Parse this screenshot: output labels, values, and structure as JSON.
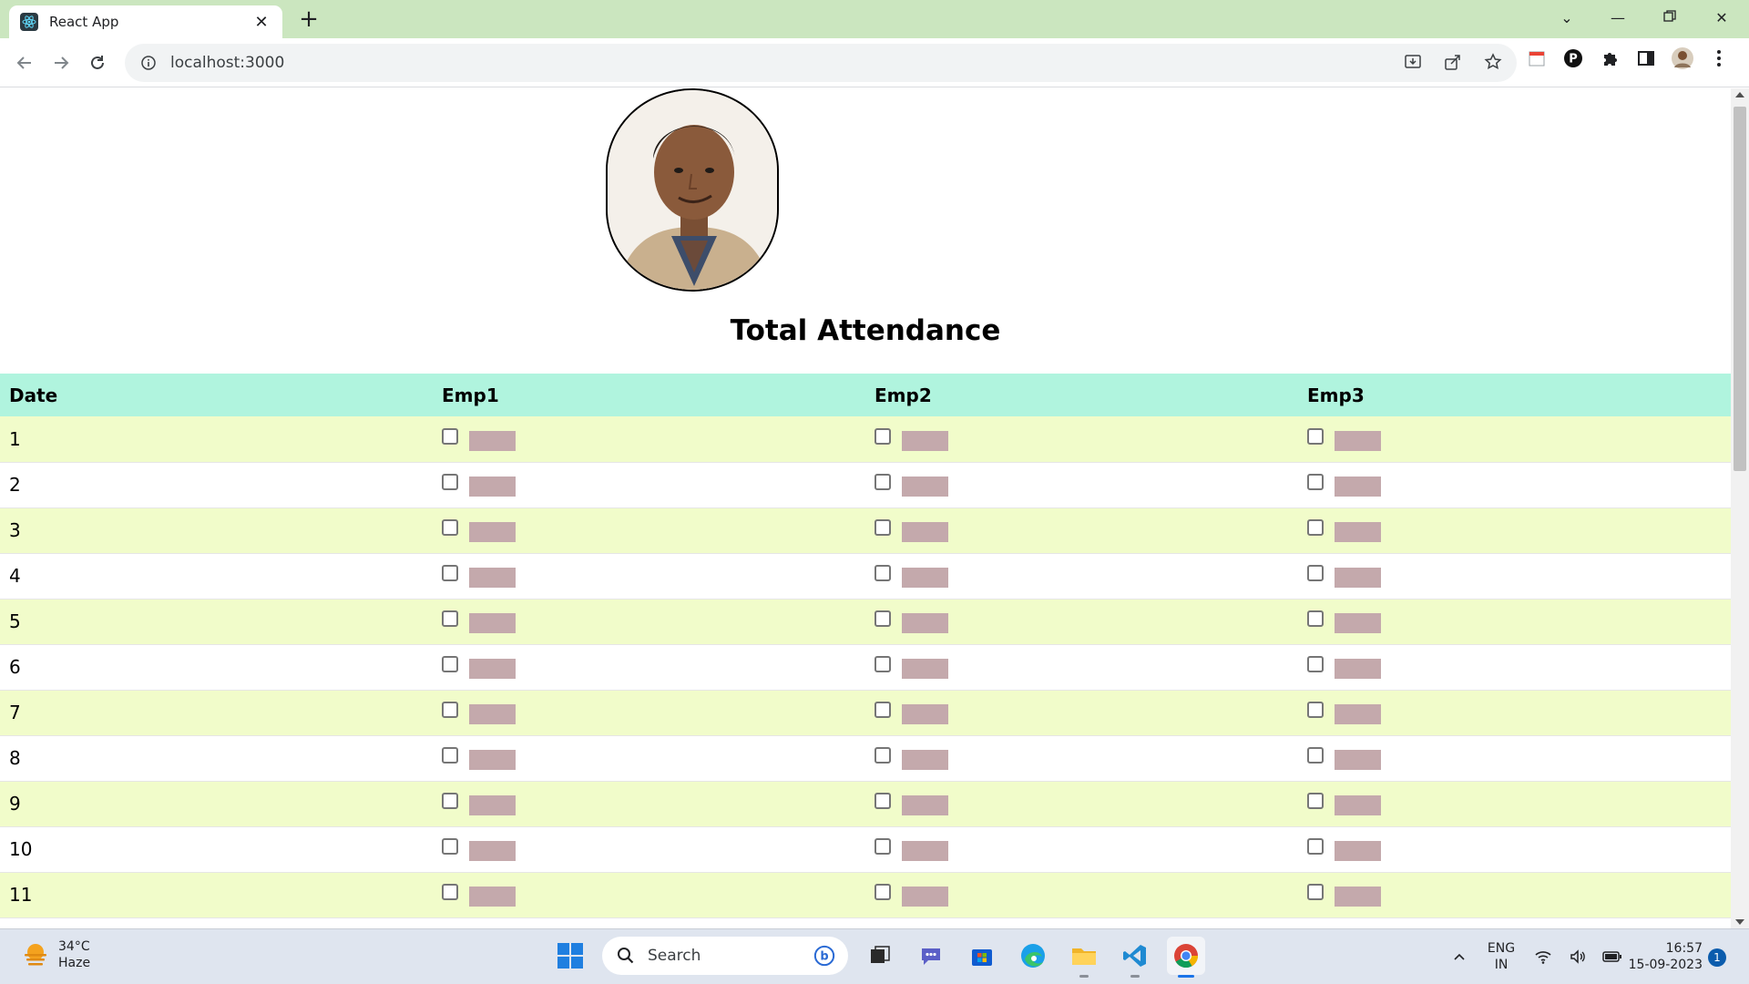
{
  "browser": {
    "tab_title": "React App",
    "url": "localhost:3000",
    "colors": {
      "tabbar": "#cbe6bf",
      "accent": "#1a73e8"
    }
  },
  "page": {
    "title": "Total Attendance",
    "table": {
      "headers": [
        "Date",
        "Emp1",
        "Emp2",
        "Emp3"
      ],
      "rows": [
        {
          "date": "1"
        },
        {
          "date": "2"
        },
        {
          "date": "3"
        },
        {
          "date": "4"
        },
        {
          "date": "5"
        },
        {
          "date": "6"
        },
        {
          "date": "7"
        },
        {
          "date": "8"
        },
        {
          "date": "9"
        },
        {
          "date": "10"
        },
        {
          "date": "11"
        }
      ],
      "colors": {
        "header": "#b0f4de",
        "odd_row": "#f1fcca",
        "even_row": "#ffffff",
        "cell_box": "#c4a9ac"
      }
    }
  },
  "taskbar": {
    "weather": {
      "temp": "34°C",
      "condition": "Haze"
    },
    "search_placeholder": "Search",
    "language": {
      "line1": "ENG",
      "line2": "IN"
    },
    "time": "16:57",
    "date": "15-09-2023",
    "notification_count": "1"
  }
}
